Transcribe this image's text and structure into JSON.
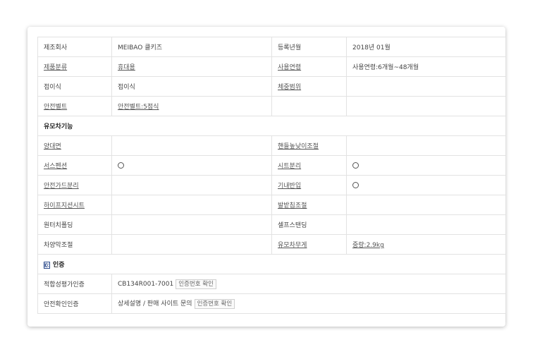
{
  "rows": [
    {
      "l1": "제조회사",
      "v1": "MEIBAO 클키즈",
      "l2": "등록년월",
      "v2": "2018년 01월"
    },
    {
      "l1": "제품분류",
      "v1": "휴대용",
      "l2": "사용연령",
      "v2": "사용연령:6개월~48개월"
    },
    {
      "l1": "접이식",
      "v1": "접이식",
      "l2": "체중범위",
      "v2": ""
    },
    {
      "l1": "안전벨트",
      "v1": "안전벨트:5점식",
      "l2": "",
      "v2": ""
    }
  ],
  "section_feature": "유모차기능",
  "feature_rows": [
    {
      "l1": "양대면",
      "v1": "",
      "l2": "핸들높낮이조절",
      "v2": ""
    },
    {
      "l1": "서스펜션",
      "v1": "○",
      "l2": "시트분리",
      "v2": "○"
    },
    {
      "l1": "안전가드분리",
      "v1": "",
      "l2": "기내반입",
      "v2": "○"
    },
    {
      "l1": "하이프지션시트",
      "v1": "",
      "l2": "발받침조절",
      "v2": ""
    },
    {
      "l1": "원터치폴딩",
      "v1": "",
      "l2": "셀프스탠딩",
      "v2": ""
    },
    {
      "l1": "차양막조절",
      "v1": "",
      "l2": "유모차무게",
      "v2": "중량:2.9kg"
    }
  ],
  "section_cert": "인증",
  "cert_rows": [
    {
      "label": "적합성평가인증",
      "value": "CB134R001-7001",
      "button": "인증번호 확인"
    },
    {
      "label": "안전확인인증",
      "value": "상세설명 / 판매 사이트 문의",
      "button": "인증번호 확인"
    }
  ],
  "colors": {
    "border": "#e2e2e2",
    "text": "#444444",
    "kc_mark": "#2b4a8b"
  }
}
